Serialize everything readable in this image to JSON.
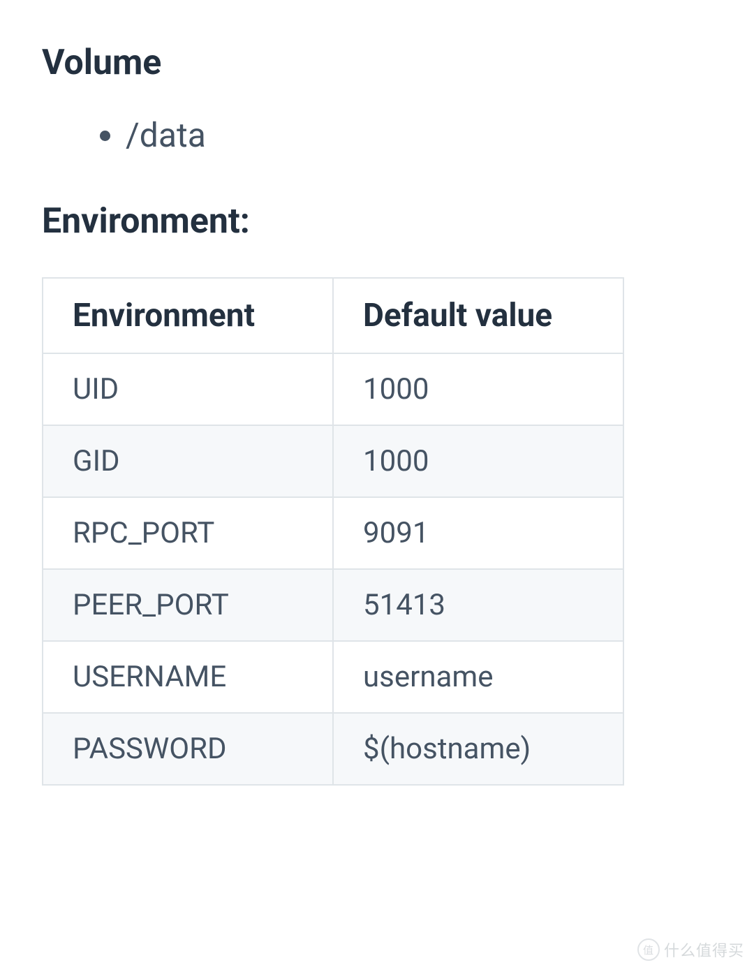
{
  "volume": {
    "heading": "Volume",
    "items": [
      "/data"
    ]
  },
  "environment": {
    "heading": "Environment:",
    "columns": [
      "Environment",
      "Default value"
    ],
    "rows": [
      {
        "name": "UID",
        "value": "1000"
      },
      {
        "name": "GID",
        "value": "1000"
      },
      {
        "name": "RPC_PORT",
        "value": "9091"
      },
      {
        "name": "PEER_PORT",
        "value": "51413"
      },
      {
        "name": "USERNAME",
        "value": "username"
      },
      {
        "name": "PASSWORD",
        "value": "$(hostname)"
      }
    ]
  },
  "watermark": {
    "icon": "值",
    "text": "什么值得买"
  }
}
